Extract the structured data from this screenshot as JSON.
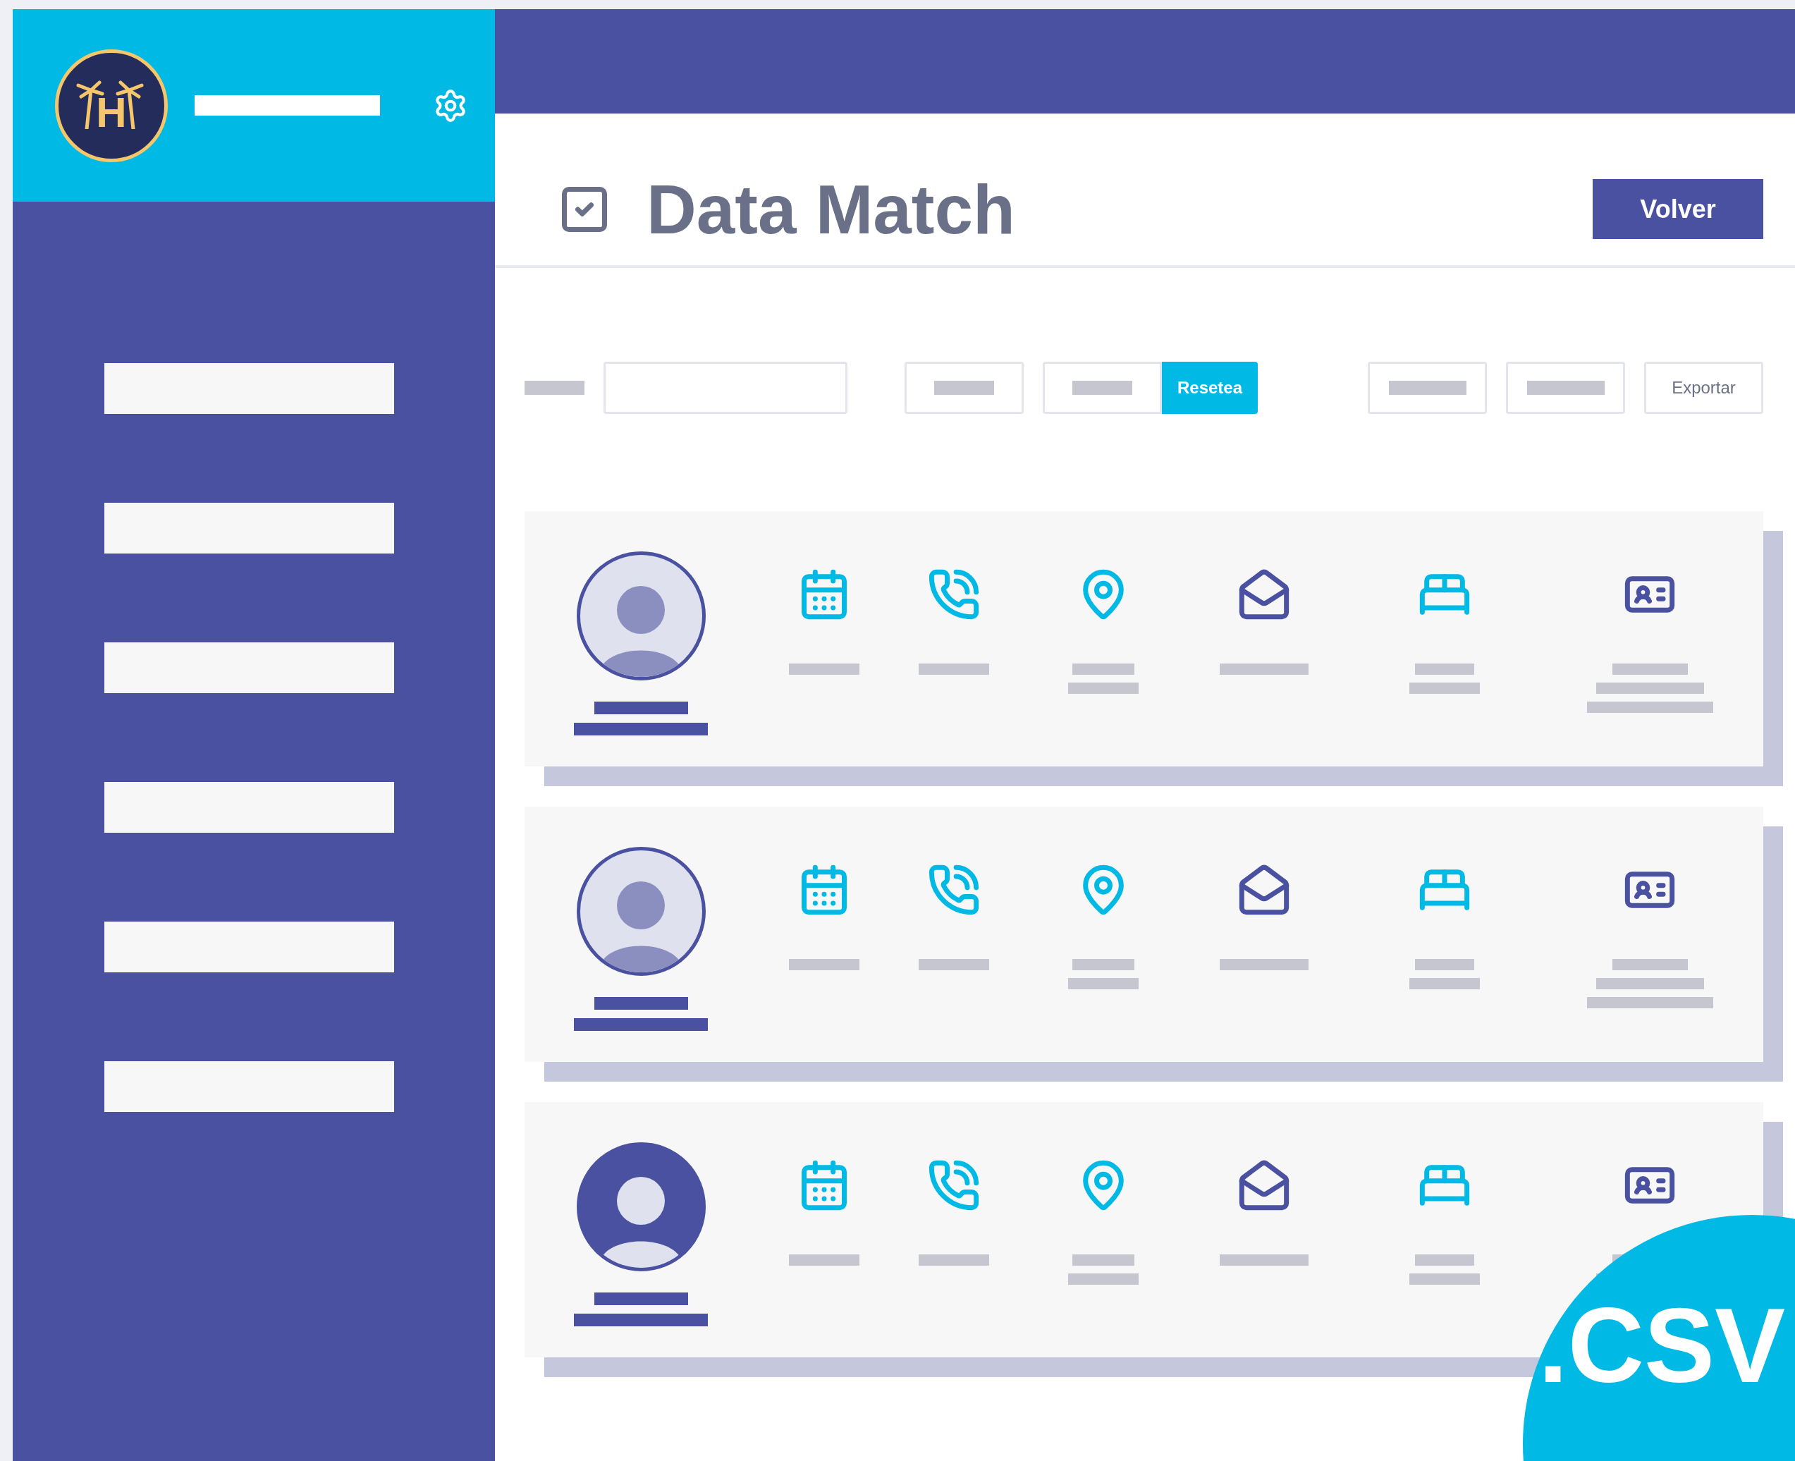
{
  "logo": {
    "letter": "H"
  },
  "header": {
    "title": "Data Match",
    "back_button": "Volver"
  },
  "toolbar": {
    "reset_button": "Resetea",
    "export_button": "Exportar"
  },
  "records": [
    {
      "kind": "outlined"
    },
    {
      "kind": "outlined"
    },
    {
      "kind": "filled"
    }
  ],
  "badge": {
    "label": ".CSV"
  }
}
